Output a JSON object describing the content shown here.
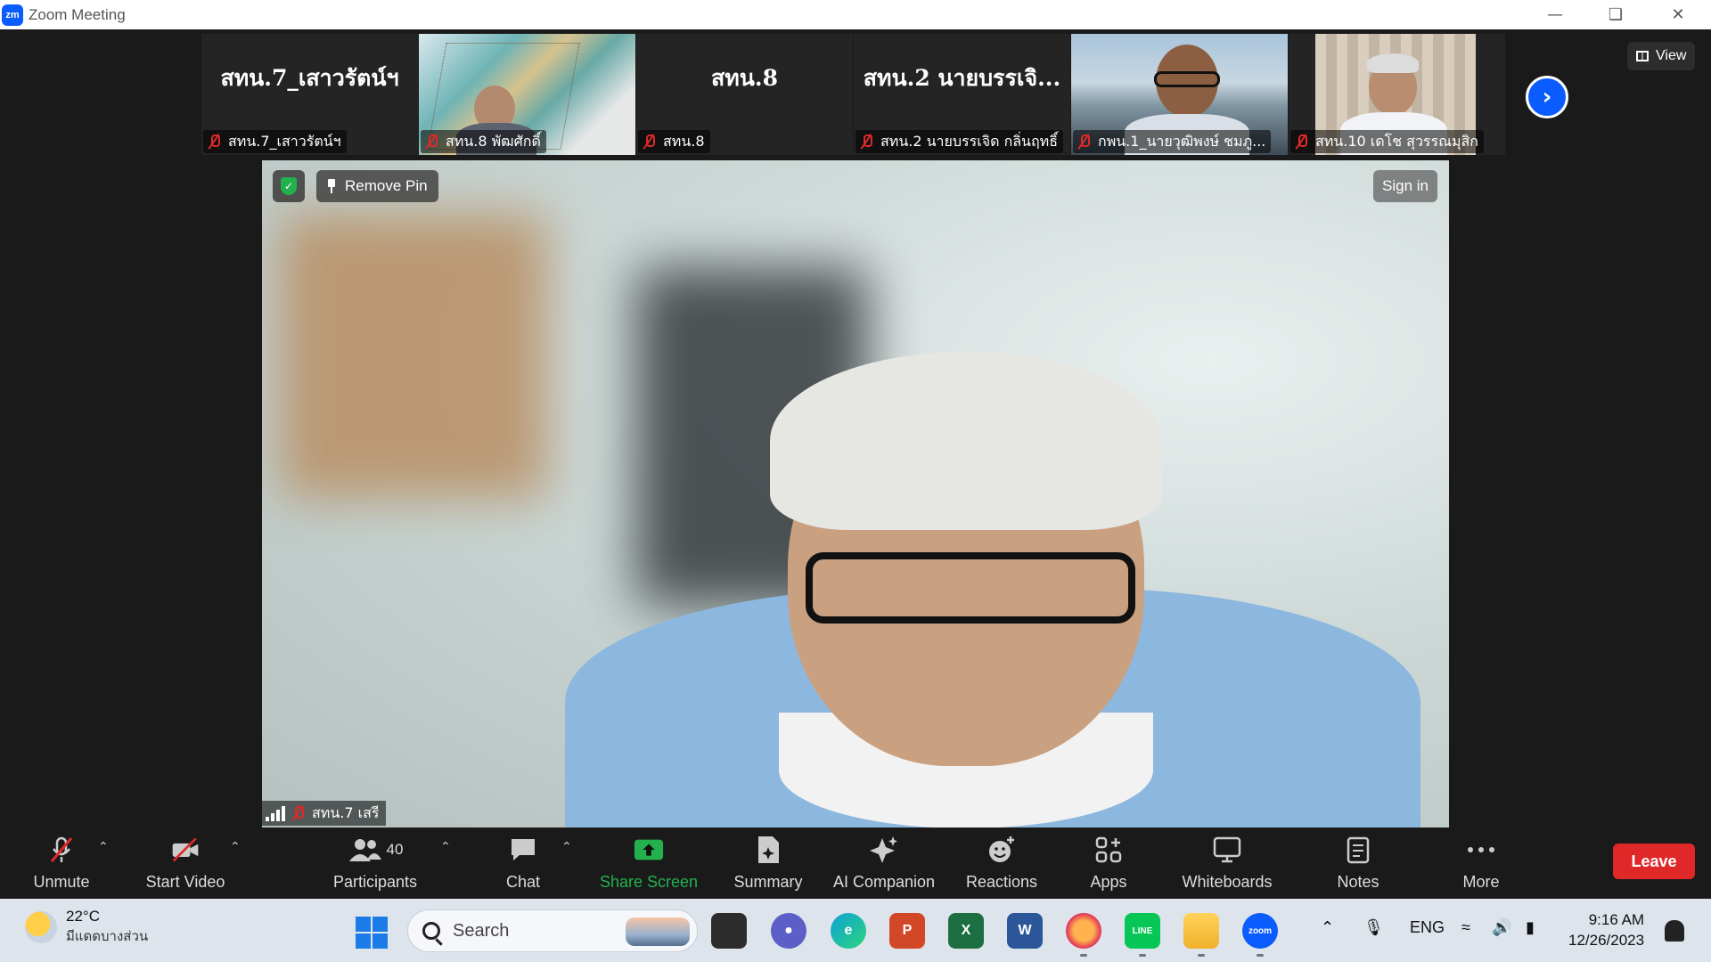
{
  "window": {
    "logo": "zm",
    "title": "Zoom Meeting",
    "controls": [
      "minimize-icon",
      "restore-icon",
      "close-icon"
    ]
  },
  "view_button": {
    "label": "View",
    "icon": "gallery-grid-icon"
  },
  "gallery": [
    {
      "big_name": "สทน.7_เสาวรัตน์ฯ",
      "caption": "สทน.7_เสาวรัตน์ฯ",
      "muted": true,
      "video": false
    },
    {
      "big_name": "",
      "caption": "สทน.8 พัฒศักดิ์",
      "muted": true,
      "video": true,
      "scene": "map"
    },
    {
      "big_name": "สทน.8",
      "caption": "สทน.8",
      "muted": true,
      "video": false
    },
    {
      "big_name": "สทน.2 นายบรรเจิ...",
      "caption": "สทน.2 นายบรรเจิด กลิ่นฤทธิ์",
      "muted": true,
      "video": false
    },
    {
      "big_name": "",
      "caption": "กพน.1_นายวุฒิพงษ์ ชมภู...",
      "muted": true,
      "video": true,
      "scene": "outdoor"
    },
    {
      "big_name": "",
      "caption": "สทน.10 เดโช สุวรรณมุสิก",
      "muted": true,
      "video": true,
      "scene": "curtain"
    }
  ],
  "main_video": {
    "remove_pin_label": "Remove Pin",
    "sign_in_label": "Sign in",
    "speaker_caption": "สทน.7 เสรี",
    "muted": true
  },
  "toolbar": {
    "unmute": "Unmute",
    "start_video": "Start Video",
    "participants": "Participants",
    "participants_count": "40",
    "chat": "Chat",
    "share_screen": "Share Screen",
    "summary": "Summary",
    "ai_companion": "AI Companion",
    "reactions": "Reactions",
    "apps": "Apps",
    "whiteboards": "Whiteboards",
    "notes": "Notes",
    "more": "More",
    "leave": "Leave"
  },
  "taskbar": {
    "weather_temp": "22°C",
    "weather_desc": "มีแดดบางส่วน",
    "search_placeholder": "Search",
    "language": "ENG",
    "time": "9:16 AM",
    "date": "12/26/2023",
    "zoom_label": "zoom",
    "line_label": "LINE",
    "word_label": "W",
    "excel_label": "X",
    "powerpoint_label": "P"
  },
  "colors": {
    "accent_blue": "#0b5cff",
    "leave_red": "#e02828",
    "share_green": "#23b14d",
    "muted_red": "#e02828"
  }
}
